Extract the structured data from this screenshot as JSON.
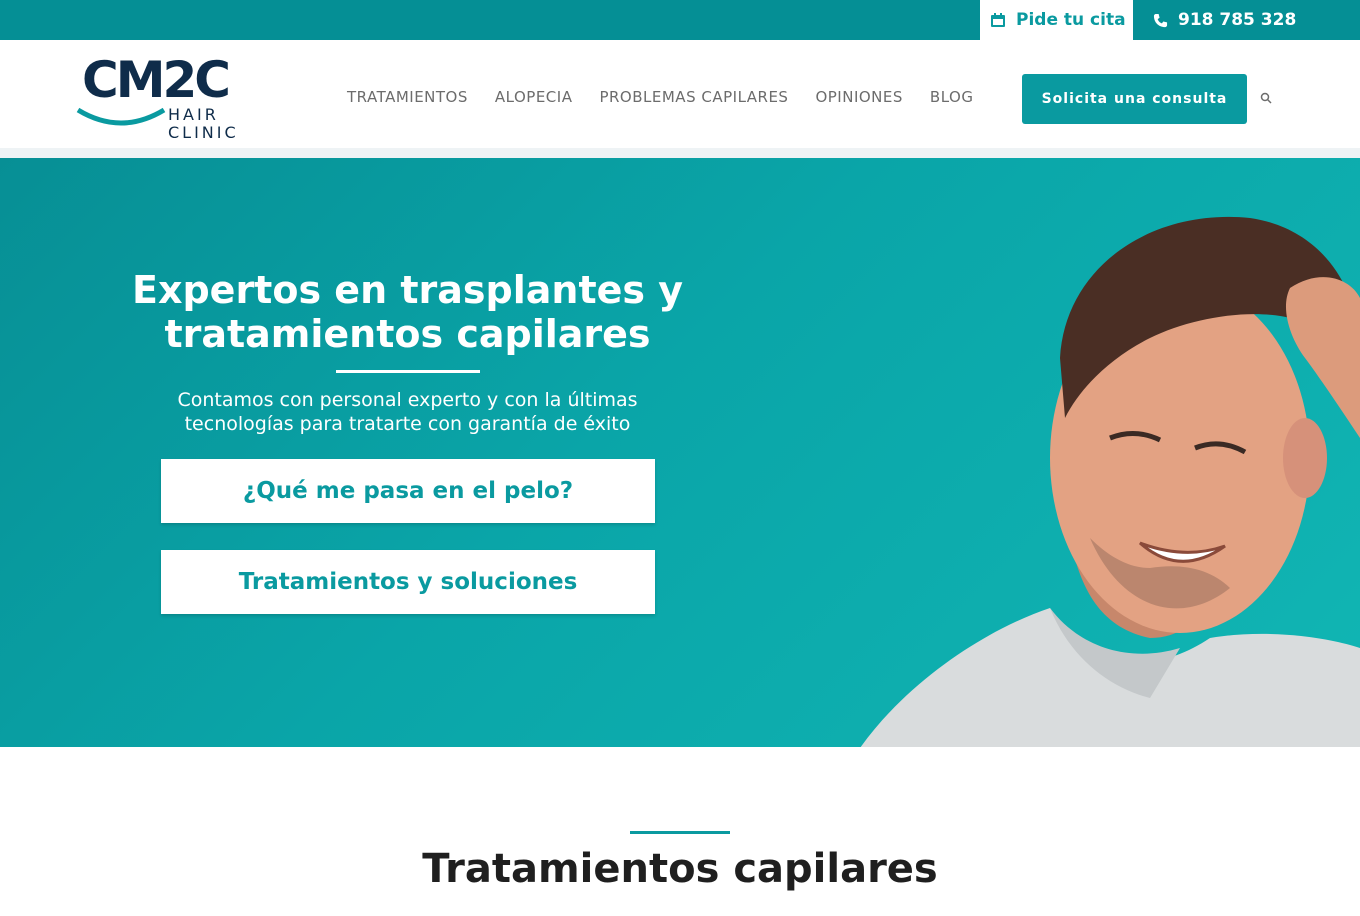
{
  "topbar": {
    "appointment_label": "Pide tu cita",
    "phone_label": "918 785 328"
  },
  "logo": {
    "mark": "CM2C",
    "line1": "HAIR",
    "line2": "CLINIC"
  },
  "nav": {
    "items": [
      {
        "label": "TRATAMIENTOS"
      },
      {
        "label": "ALOPECIA"
      },
      {
        "label": "PROBLEMAS CAPILARES"
      },
      {
        "label": "OPINIONES"
      },
      {
        "label": "BLOG"
      }
    ],
    "cta_label": "Solicita una consulta"
  },
  "hero": {
    "title": "Expertos en trasplantes y tratamientos capilares",
    "subtitle": "Contamos con personal experto y con la últimas tecnologías para tratarte con garantía de éxito",
    "button1": "¿Qué me pasa en el pelo?",
    "button2": "Tratamientos y soluciones"
  },
  "section": {
    "title": "Tratamientos capilares"
  },
  "colors": {
    "brand_teal": "#0a9aa0",
    "topbar_teal": "#058f95",
    "logo_navy": "#0f2c4a"
  }
}
